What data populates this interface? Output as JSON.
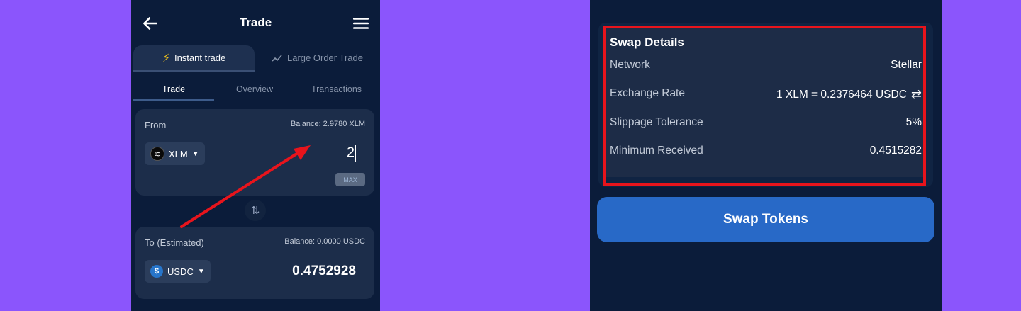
{
  "left": {
    "header": {
      "title": "Trade",
      "back_icon": "arrow-left-icon",
      "menu_icon": "hamburger-menu-icon"
    },
    "mode_tabs": {
      "instant": "Instant trade",
      "large": "Large Order Trade",
      "active": "instant"
    },
    "sub_tabs": {
      "trade": "Trade",
      "overview": "Overview",
      "transactions": "Transactions",
      "active": "trade"
    },
    "from": {
      "label": "From",
      "balance": "Balance: 2.9780 XLM",
      "token": "XLM",
      "amount": "2",
      "max_label": "MAX"
    },
    "to": {
      "label": "To (Estimated)",
      "balance": "Balance: 0.0000 USDC",
      "token": "USDC",
      "amount": "0.4752928"
    }
  },
  "right": {
    "details": {
      "title": "Swap Details",
      "rows": [
        {
          "key": "Network",
          "value": "Stellar"
        },
        {
          "key": "Exchange Rate",
          "value": "1 XLM = 0.2376464 USDC"
        },
        {
          "key": "Slippage Tolerance",
          "value": "5%"
        },
        {
          "key": "Minimum Received",
          "value": "0.4515282"
        }
      ]
    },
    "swap_button": "Swap Tokens"
  },
  "colors": {
    "background": "#8b55fc",
    "panel": "#0b1c3a",
    "card": "#1c2d4a",
    "accent_button": "#2869c7",
    "annotation_red": "#e8141c"
  }
}
